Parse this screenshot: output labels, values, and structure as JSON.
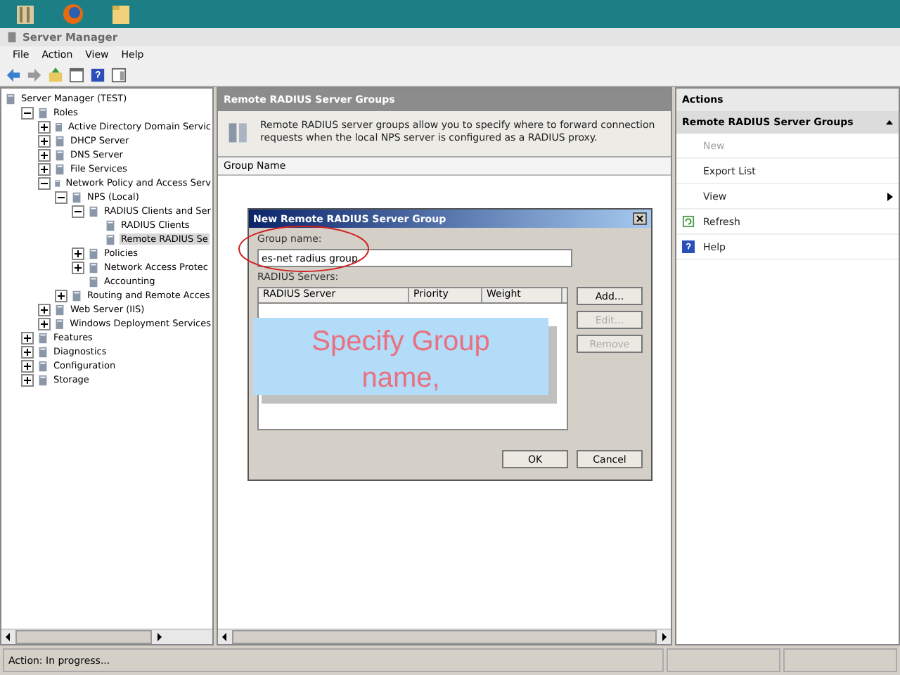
{
  "window": {
    "title": "Server Manager"
  },
  "menu": [
    "File",
    "Action",
    "View",
    "Help"
  ],
  "tree": [
    {
      "label": "Server Manager (TEST)",
      "selected": false,
      "children": [
        {
          "label": "Roles",
          "expanded": true,
          "selected": false,
          "children": [
            {
              "label": "Active Directory Domain Servic",
              "expanded": false,
              "selected": false
            },
            {
              "label": "DHCP Server",
              "expanded": false,
              "selected": false
            },
            {
              "label": "DNS Server",
              "expanded": false,
              "selected": false
            },
            {
              "label": "File Services",
              "expanded": false,
              "selected": false
            },
            {
              "label": "Network Policy and Access Serv",
              "expanded": true,
              "selected": false,
              "children": [
                {
                  "label": "NPS (Local)",
                  "expanded": true,
                  "selected": false,
                  "children": [
                    {
                      "label": "RADIUS Clients and Ser",
                      "expanded": true,
                      "selected": false,
                      "children": [
                        {
                          "label": "RADIUS Clients",
                          "selected": false
                        },
                        {
                          "label": "Remote RADIUS Se",
                          "selected": true
                        }
                      ]
                    },
                    {
                      "label": "Policies",
                      "expanded": false,
                      "selected": false
                    },
                    {
                      "label": "Network Access Protec",
                      "expanded": false,
                      "selected": false
                    },
                    {
                      "label": "Accounting",
                      "selected": false
                    }
                  ]
                },
                {
                  "label": "Routing and Remote Acces",
                  "expanded": false,
                  "selected": false
                }
              ]
            },
            {
              "label": "Web Server (IIS)",
              "expanded": false,
              "selected": false
            },
            {
              "label": "Windows Deployment Services",
              "expanded": false,
              "selected": false
            }
          ]
        },
        {
          "label": "Features",
          "expanded": false,
          "selected": false
        },
        {
          "label": "Diagnostics",
          "expanded": false,
          "selected": false
        },
        {
          "label": "Configuration",
          "expanded": false,
          "selected": false
        },
        {
          "label": "Storage",
          "expanded": false,
          "selected": false
        }
      ]
    }
  ],
  "center": {
    "title": "Remote RADIUS Server Groups",
    "description": "Remote RADIUS server groups allow you to specify where to forward connection requests when the local NPS server is configured as a RADIUS proxy.",
    "columns": [
      "Group Name"
    ]
  },
  "actions": {
    "title": "Actions",
    "section": "Remote RADIUS Server Groups",
    "items": [
      {
        "label": "New",
        "disabled": true,
        "kind": "plain"
      },
      {
        "label": "Export List",
        "disabled": false,
        "kind": "plain"
      },
      {
        "label": "View",
        "disabled": false,
        "kind": "submenu"
      },
      {
        "label": "Refresh",
        "disabled": false,
        "kind": "refresh"
      },
      {
        "label": "Help",
        "disabled": false,
        "kind": "help"
      }
    ]
  },
  "dialog": {
    "title": "New Remote RADIUS Server Group",
    "group_label": "Group name:",
    "group_value": "es-net radius group",
    "servers_label": "RADIUS Servers:",
    "columns": [
      "RADIUS Server",
      "Priority",
      "Weight"
    ],
    "side_buttons": [
      {
        "label": "Add...",
        "disabled": false
      },
      {
        "label": "Edit...",
        "disabled": true
      },
      {
        "label": "Remove",
        "disabled": true
      }
    ],
    "buttons": [
      "OK",
      "Cancel"
    ]
  },
  "callout": {
    "text": "Specify Group name,"
  },
  "status_bar": {
    "text": "Action:  In progress..."
  }
}
